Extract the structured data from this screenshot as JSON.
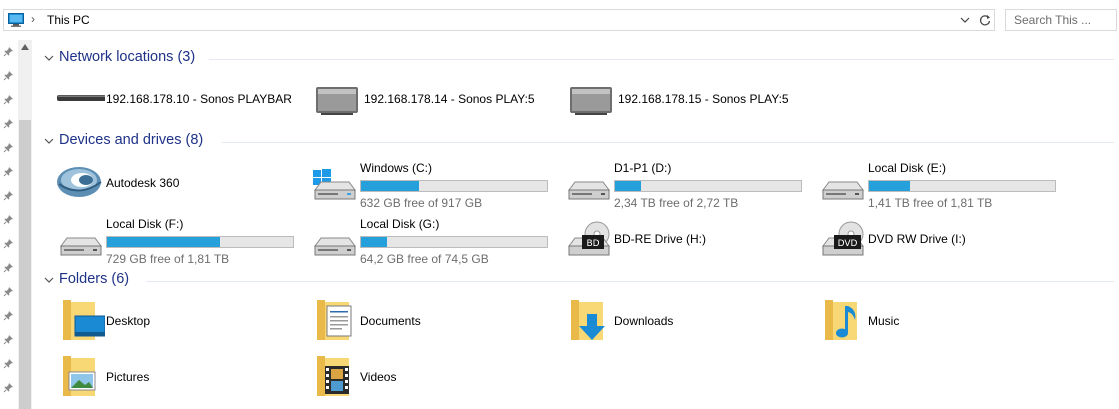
{
  "address": {
    "location": "This PC",
    "separator": "›"
  },
  "search": {
    "placeholder": "Search This ..."
  },
  "groups": [
    {
      "title": "Network locations (3)",
      "items": [
        {
          "label": "192.168.178.10 - Sonos PLAYBAR",
          "icon": "soundbar-icon"
        },
        {
          "label": "192.168.178.14 - Sonos PLAY:5",
          "icon": "speaker-icon"
        },
        {
          "label": "192.168.178.15 - Sonos PLAY:5",
          "icon": "speaker-icon"
        }
      ]
    },
    {
      "title": "Devices and drives (8)",
      "items": [
        {
          "label": "Autodesk 360",
          "icon": "autodesk-360-icon"
        },
        {
          "label": "Windows (C:)",
          "free": "632 GB free of 917 GB",
          "used_fraction": 0.311,
          "icon": "windows-drive-icon"
        },
        {
          "label": "D1-P1 (D:)",
          "free": "2,34 TB free of 2,72 TB",
          "used_fraction": 0.14,
          "icon": "hard-drive-icon"
        },
        {
          "label": "Local Disk (E:)",
          "free": "1,41 TB free of 1,81 TB",
          "used_fraction": 0.221,
          "icon": "hard-drive-icon"
        },
        {
          "label": "Local Disk (F:)",
          "free": "729 GB free of 1,81 TB",
          "used_fraction": 0.607,
          "icon": "hard-drive-icon"
        },
        {
          "label": "Local Disk (G:)",
          "free": "64,2 GB free of 74,5 GB",
          "used_fraction": 0.138,
          "icon": "hard-drive-icon"
        },
        {
          "label": "BD-RE Drive (H:)",
          "badge": "BD",
          "icon": "bd-drive-icon"
        },
        {
          "label": "DVD RW Drive (I:)",
          "badge": "DVD",
          "icon": "dvd-drive-icon"
        }
      ]
    },
    {
      "title": "Folders (6)",
      "items": [
        {
          "label": "Desktop",
          "icon": "desktop-folder-icon"
        },
        {
          "label": "Documents",
          "icon": "documents-folder-icon"
        },
        {
          "label": "Downloads",
          "icon": "downloads-folder-icon"
        },
        {
          "label": "Music",
          "icon": "music-folder-icon"
        },
        {
          "label": "Pictures",
          "icon": "pictures-folder-icon"
        },
        {
          "label": "Videos",
          "icon": "videos-folder-icon"
        }
      ]
    }
  ],
  "colors": {
    "accent": "#26a0da",
    "group_title": "#1e3287",
    "folder": "#f8d775"
  }
}
